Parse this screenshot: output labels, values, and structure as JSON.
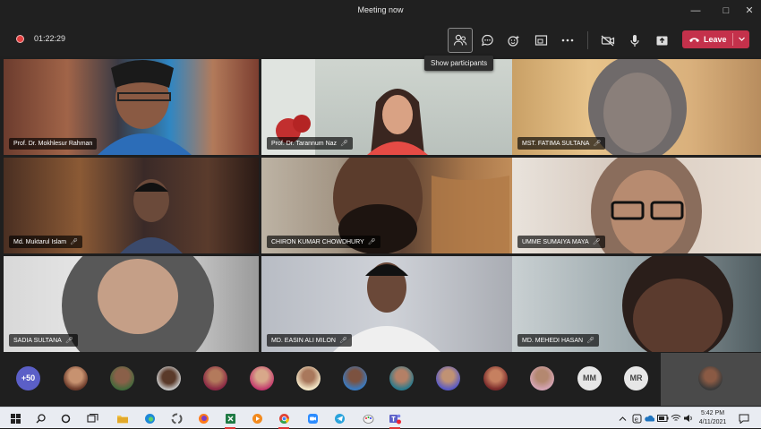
{
  "window": {
    "title": "Meeting now"
  },
  "toolbar": {
    "timer": "01:22:29",
    "tooltip": "Show participants",
    "leave_label": "Leave"
  },
  "participants": [
    {
      "name": "Prof. Dr. Mokhlesur Rahman",
      "muted": false
    },
    {
      "name": "Prof. Dr. Tarannum Naz",
      "muted": true
    },
    {
      "name": "MST. FATIMA SULTANA",
      "muted": true
    },
    {
      "name": "Md. Muktarul Islam",
      "muted": true
    },
    {
      "name": "CHIRON KUMAR CHOWDHURY",
      "muted": true
    },
    {
      "name": "UMME SUMAIYA MAYA",
      "muted": true
    },
    {
      "name": "SADIA SULTANA",
      "muted": true
    },
    {
      "name": "MD. EASIN ALI MILON",
      "muted": true
    },
    {
      "name": "MD. MEHEDI HASAN",
      "muted": true
    }
  ],
  "overflow": {
    "more_count": "+50",
    "initials": [
      "MM",
      "MR"
    ]
  },
  "taskbar": {
    "time": "5:42 PM",
    "date": "4/11/2021"
  },
  "colors": {
    "leave": "#c4314b",
    "accent": "#5b5fc7",
    "background": "#1f1f1f"
  }
}
